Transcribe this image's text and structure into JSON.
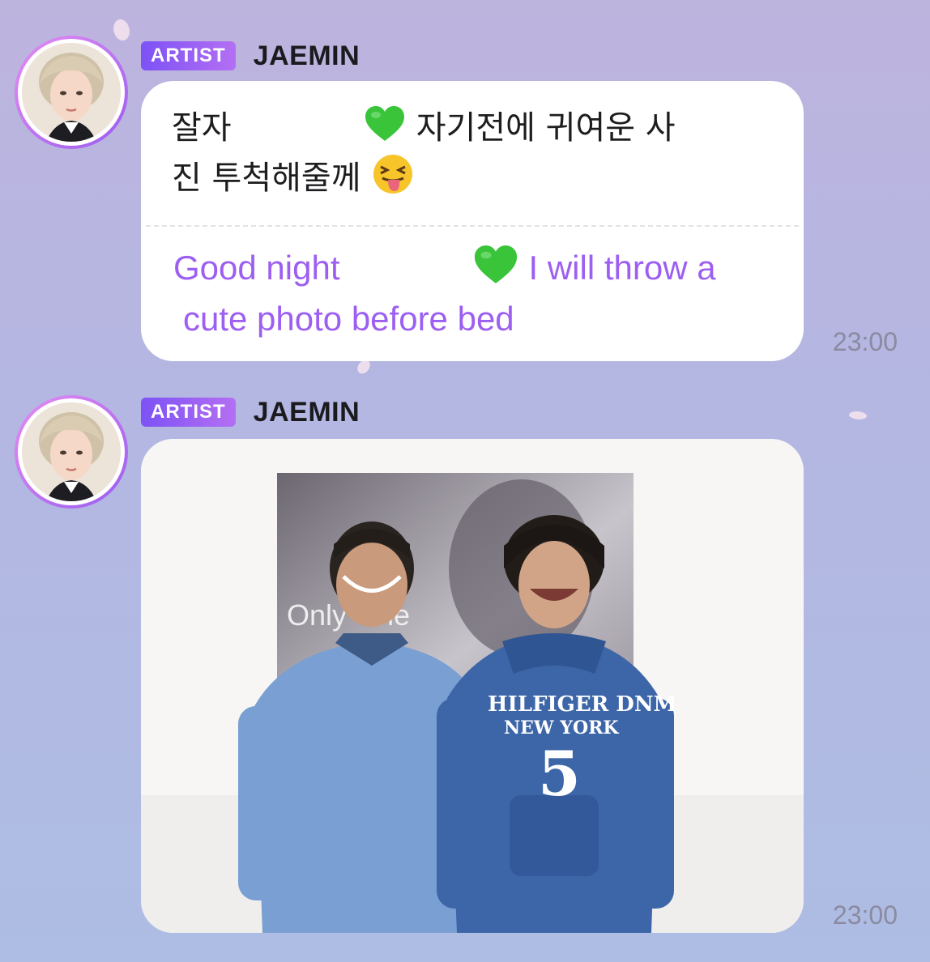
{
  "messages": [
    {
      "badge": "ARTIST",
      "author": "JAEMIN",
      "korean_line1_a": "잘자",
      "korean_line1_b": "자기전에 귀여운 사",
      "korean_line2": "진 투척해줄께",
      "translation_line1_a": "Good night",
      "translation_line1_b": "I will throw a",
      "translation_line2": "cute photo before bed",
      "emoji_heart": "green-heart-icon",
      "emoji_face": "squinting-tongue-face-icon",
      "time": "23:00"
    },
    {
      "badge": "ARTIST",
      "author": "JAEMIN",
      "photo": {
        "poster_text": "Only One",
        "hoodie_text_top": "HILFIGER DNM",
        "hoodie_text_bottom": "NEW YORK",
        "hoodie_number": "5"
      },
      "time": "23:00"
    }
  ],
  "colors": {
    "badge_start": "#7d52f5",
    "badge_end": "#b46ff3",
    "translation": "#9d5ff2",
    "time": "#8a8aa0",
    "heart": "#3ac43a"
  }
}
